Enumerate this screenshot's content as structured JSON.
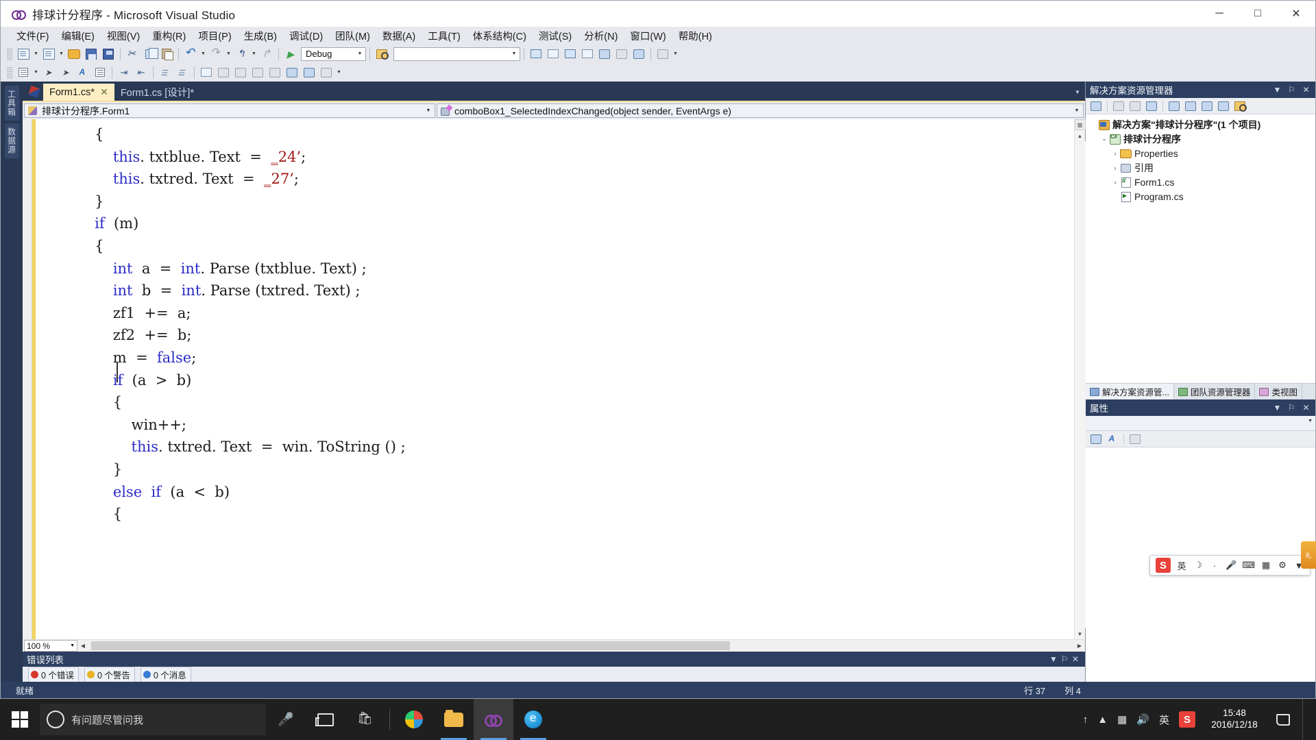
{
  "window": {
    "title": "排球计分程序 - Microsoft Visual Studio",
    "minimize": "─",
    "maximize": "□",
    "close": "✕"
  },
  "menubar": {
    "items": [
      "文件(F)",
      "编辑(E)",
      "视图(V)",
      "重构(R)",
      "项目(P)",
      "生成(B)",
      "调试(D)",
      "团队(M)",
      "数据(A)",
      "工具(T)",
      "体系结构(C)",
      "测试(S)",
      "分析(N)",
      "窗口(W)",
      "帮助(H)"
    ]
  },
  "toolbar": {
    "config_value": "Debug",
    "find_value": "",
    "dropdown_arrow": "▼"
  },
  "left_rail": {
    "tabs": [
      "工具箱",
      "数据源"
    ]
  },
  "tabs": {
    "items": [
      {
        "label": "Form1.cs*",
        "active": true,
        "close": "✕"
      },
      {
        "label": "Form1.cs [设计]*",
        "active": false,
        "close": ""
      }
    ]
  },
  "navbar": {
    "class_value": "排球计分程序.Form1",
    "member_value": "comboBox1_SelectedIndexChanged(object sender, EventArgs e)",
    "arrow": "▼"
  },
  "editor": {
    "zoom": "100 %",
    "code_lines": [
      {
        "indent": 0,
        "segments": [
          {
            "t": "            {",
            "c": "plain"
          }
        ]
      },
      {
        "indent": 0,
        "segments": [
          {
            "t": "                ",
            "c": "plain"
          },
          {
            "t": "this",
            "c": "kw"
          },
          {
            "t": ". txtblue. Text  =  ",
            "c": "plain"
          },
          {
            "t": "‗24’",
            "c": "str"
          },
          {
            "t": ";",
            "c": "plain"
          }
        ]
      },
      {
        "indent": 0,
        "segments": [
          {
            "t": "                ",
            "c": "plain"
          },
          {
            "t": "this",
            "c": "kw"
          },
          {
            "t": ". txtred. Text  =  ",
            "c": "plain"
          },
          {
            "t": "‗27’",
            "c": "str"
          },
          {
            "t": ";",
            "c": "plain"
          }
        ]
      },
      {
        "indent": 0,
        "segments": [
          {
            "t": "            }",
            "c": "plain"
          }
        ]
      },
      {
        "indent": 0,
        "segments": [
          {
            "t": "            ",
            "c": "plain"
          },
          {
            "t": "if",
            "c": "kw"
          },
          {
            "t": "  (m)",
            "c": "plain"
          }
        ]
      },
      {
        "indent": 0,
        "segments": [
          {
            "t": "            {",
            "c": "plain"
          }
        ]
      },
      {
        "indent": 0,
        "segments": [
          {
            "t": "                ",
            "c": "plain"
          },
          {
            "t": "int",
            "c": "kw"
          },
          {
            "t": "  a  =  ",
            "c": "plain"
          },
          {
            "t": "int",
            "c": "kw"
          },
          {
            "t": ". Parse (txtblue. Text) ;",
            "c": "plain"
          }
        ]
      },
      {
        "indent": 0,
        "segments": [
          {
            "t": "                ",
            "c": "plain"
          },
          {
            "t": "int",
            "c": "kw"
          },
          {
            "t": "  b  =  ",
            "c": "plain"
          },
          {
            "t": "int",
            "c": "kw"
          },
          {
            "t": ". Parse (txtred. Text) ;",
            "c": "plain"
          }
        ]
      },
      {
        "indent": 0,
        "segments": [
          {
            "t": "                zf1  +=  a;",
            "c": "plain"
          }
        ]
      },
      {
        "indent": 0,
        "segments": [
          {
            "t": "                zf2  +=  b;",
            "c": "plain"
          }
        ]
      },
      {
        "indent": 0,
        "segments": [
          {
            "t": "                m  =  ",
            "c": "plain"
          },
          {
            "t": "false",
            "c": "kw"
          },
          {
            "t": ";",
            "c": "plain"
          }
        ]
      },
      {
        "indent": 0,
        "segments": [
          {
            "t": "                ",
            "c": "plain"
          },
          {
            "t": "if",
            "c": "kw"
          },
          {
            "t": "  (a  >  b)",
            "c": "plain"
          }
        ]
      },
      {
        "indent": 0,
        "segments": [
          {
            "t": "                {",
            "c": "plain"
          }
        ]
      },
      {
        "indent": 0,
        "segments": [
          {
            "t": "                    win++;",
            "c": "plain"
          }
        ]
      },
      {
        "indent": 0,
        "segments": [
          {
            "t": "                    ",
            "c": "plain"
          },
          {
            "t": "this",
            "c": "kw"
          },
          {
            "t": ". txtred. Text  =  win. ToString () ;",
            "c": "plain"
          }
        ]
      },
      {
        "indent": 0,
        "segments": [
          {
            "t": "                }",
            "c": "plain"
          }
        ]
      },
      {
        "indent": 0,
        "segments": [
          {
            "t": "                ",
            "c": "plain"
          },
          {
            "t": "else",
            "c": "kw"
          },
          {
            "t": "  ",
            "c": "plain"
          },
          {
            "t": "if",
            "c": "kw"
          },
          {
            "t": "  (a  <  b)",
            "c": "plain"
          }
        ]
      },
      {
        "indent": 0,
        "segments": [
          {
            "t": "                {",
            "c": "plain"
          }
        ]
      }
    ]
  },
  "error_list": {
    "title": "错误列表",
    "chips": [
      {
        "label": "0 个错误",
        "kind": "error"
      },
      {
        "label": "0 个警告",
        "kind": "warning"
      },
      {
        "label": "0 个消息",
        "kind": "info"
      }
    ],
    "pin": "⚐",
    "close": "✕",
    "dropdown": "▼"
  },
  "solution_explorer": {
    "title": "解决方案资源管理器",
    "dropdown": "▼",
    "pin": "⚐",
    "close": "✕",
    "tree": [
      {
        "label": "解决方案\"排球计分程序\"(1 个项目)",
        "depth": 0,
        "icon": "sln",
        "twisty": "",
        "bold": true
      },
      {
        "label": "排球计分程序",
        "depth": 1,
        "icon": "proj",
        "twisty": "⌄",
        "bold": true
      },
      {
        "label": "Properties",
        "depth": 2,
        "icon": "fold",
        "twisty": "›",
        "bold": false
      },
      {
        "label": "引用",
        "depth": 2,
        "icon": "ref",
        "twisty": "›",
        "bold": false
      },
      {
        "label": "Form1.cs",
        "depth": 2,
        "icon": "cs",
        "twisty": "›",
        "bold": false
      },
      {
        "label": "Program.cs",
        "depth": 2,
        "icon": "prog",
        "twisty": "",
        "bold": false
      }
    ],
    "bottom_tabs": [
      {
        "label": "解决方案资源管...",
        "active": true
      },
      {
        "label": "团队资源管理器",
        "active": false
      },
      {
        "label": "类视图",
        "active": false
      }
    ]
  },
  "properties": {
    "title": "属性",
    "dropdown": "▼",
    "pin": "⚐",
    "close": "✕",
    "combo_value": ""
  },
  "statusbar": {
    "ready": "就绪",
    "line_label": "行 37",
    "col_label": "列 4"
  },
  "ime": {
    "logo": "S",
    "mode": "英",
    "items": [
      "☽",
      "·",
      "🎤",
      "⌨",
      "▦",
      "⚙",
      "▼"
    ]
  },
  "taskbar": {
    "search_placeholder": "有问题尽管问我",
    "tray": [
      "↑",
      "▲",
      "🔊",
      "⌨"
    ],
    "ime_lang": "英",
    "ime_logo": "S",
    "time": "15:48",
    "date": "2016/12/18",
    "apps": [
      {
        "name": "mic-icon"
      },
      {
        "name": "task-view-icon"
      },
      {
        "name": "store-icon"
      },
      {
        "name": "paint-icon"
      },
      {
        "name": "file-explorer-icon"
      },
      {
        "name": "visual-studio-icon"
      },
      {
        "name": "edge-icon"
      }
    ]
  },
  "side_gift": {
    "label": "礼"
  }
}
